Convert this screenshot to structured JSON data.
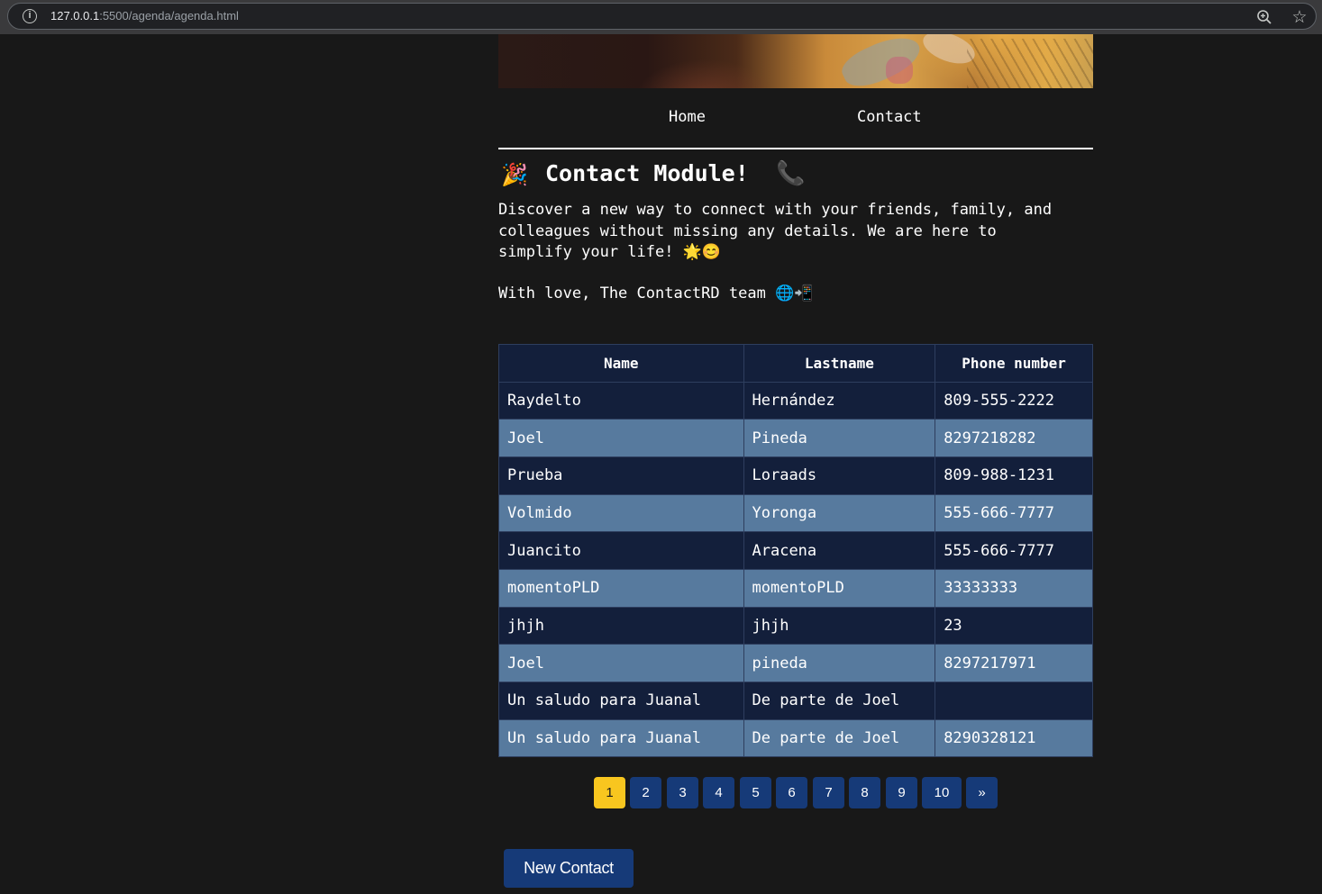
{
  "browser": {
    "url_host": "127.0.0.1",
    "url_rest": ":5500/agenda/agenda.html",
    "info_glyph": "i",
    "star_glyph": "☆"
  },
  "nav": {
    "home_label": "Home",
    "contact_label": "Contact"
  },
  "header": {
    "emoji_left": "🎉",
    "title": "Contact Module!",
    "emoji_right": "📞"
  },
  "intro": {
    "text": "Discover a new way to connect with your friends, family, and\ncolleagues without missing any details. We are here to\nsimplify your life! 🌟😊",
    "signature": "With love, The ContactRD team 🌐📲"
  },
  "table": {
    "headers": [
      "Name",
      "Lastname",
      "Phone number"
    ],
    "rows": [
      [
        "Raydelto",
        "Hernández",
        "809-555-2222"
      ],
      [
        "Joel",
        "Pineda",
        "8297218282"
      ],
      [
        "Prueba",
        "Loraads",
        "809-988-1231"
      ],
      [
        "Volmido",
        "Yoronga",
        "555-666-7777"
      ],
      [
        "Juancito",
        "Aracena",
        "555-666-7777"
      ],
      [
        "momentoPLD",
        "momentoPLD",
        "33333333"
      ],
      [
        "jhjh",
        "jhjh",
        "23"
      ],
      [
        "Joel",
        "pineda",
        "8297217971"
      ],
      [
        "Un saludo para Juanal",
        "De parte de Joel",
        ""
      ],
      [
        "Un saludo para Juanal",
        "De parte de Joel",
        "8290328121"
      ]
    ]
  },
  "pagination": {
    "pages": [
      "1",
      "2",
      "3",
      "4",
      "5",
      "6",
      "7",
      "8",
      "9",
      "10"
    ],
    "next_label": "»",
    "current": "1"
  },
  "actions": {
    "new_contact_label": "New Contact"
  },
  "colors": {
    "page_bg": "#181818",
    "table_dark_row": "#131f3b",
    "table_light_row": "#577a9e",
    "button_blue": "#163a78",
    "active_page": "#f8c61f"
  }
}
